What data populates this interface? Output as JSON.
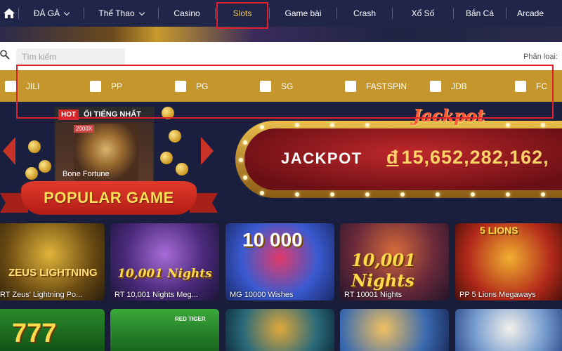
{
  "nav": {
    "home_icon": "home-icon",
    "items": [
      {
        "label": "ĐÁ GÀ",
        "dropdown": true
      },
      {
        "label": "Thể Thao",
        "dropdown": true
      },
      {
        "label": "Casino",
        "dropdown": false
      },
      {
        "label": "Slots",
        "dropdown": false,
        "active": true
      },
      {
        "label": "Game bài",
        "dropdown": false
      },
      {
        "label": "Crash",
        "dropdown": false
      },
      {
        "label": "Xổ Số",
        "dropdown": false
      },
      {
        "label": "Bắn Cá",
        "dropdown": false
      },
      {
        "label": "Arcade",
        "dropdown": false
      }
    ],
    "active_color": "#f2c94c"
  },
  "search": {
    "placeholder": "Tìm kiếm",
    "category_label": "Phân loại:"
  },
  "filters": [
    "JILI",
    "PP",
    "PG",
    "SG",
    "FASTSPIN",
    "JDB",
    "FC"
  ],
  "featured": {
    "hot_badge": "HOT",
    "heading": "ỔI TIẾNG NHẤT",
    "chip": "2000X",
    "game_name": "Bone Fortune"
  },
  "popular_label": "POPULAR GAME",
  "jackpot": {
    "script_title": "Jackpot",
    "label": "JACKPOT",
    "currency": "đ",
    "amount": "15,652,282,162,"
  },
  "games_row1": [
    {
      "title": "RT Zeus' Lightning Po...",
      "art_text": "ZEUS LIGHTNING"
    },
    {
      "title": "RT 10,001 Nights Meg...",
      "art_text": "10,001 Nights"
    },
    {
      "title": "MG 10000 Wishes",
      "art_text": "10 000"
    },
    {
      "title": "RT 10001 Nights",
      "art_text": "10,001 Nights"
    },
    {
      "title": "PP 5 Lions Megaways",
      "art_text": "5 LIONS"
    }
  ],
  "games_row2": [
    {
      "art_text": "777"
    },
    {
      "art_text": "RED TIGER"
    },
    {
      "art_text": ""
    },
    {
      "art_text": ""
    },
    {
      "art_text": ""
    }
  ],
  "colors": {
    "nav_bg": "#20254a",
    "filter_bar": "#c4962c",
    "highlight": "#e0202a",
    "page_bg": "#1a1d3a"
  }
}
